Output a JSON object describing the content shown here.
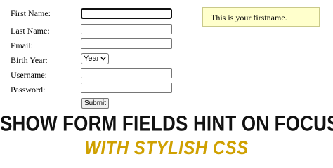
{
  "form": {
    "fields": {
      "first_name": {
        "label": "First Name:",
        "value": ""
      },
      "last_name": {
        "label": "Last Name:",
        "value": ""
      },
      "email": {
        "label": "Email:",
        "value": ""
      },
      "birth_year": {
        "label": "Birth Year:",
        "selected": "Year"
      },
      "username": {
        "label": "Username:",
        "value": ""
      },
      "password": {
        "label": "Password:",
        "value": ""
      }
    },
    "submit_label": "Submit",
    "focused_field": "first_name"
  },
  "hint": {
    "text": "This is your firstname."
  },
  "headline": {
    "line1": "SHOW FORM FIELDS HINT ON FOCUS",
    "line2": "WITH STYLISH CSS"
  },
  "colors": {
    "hint_background": "#ffffcc",
    "headline_primary": "#111111",
    "headline_accent": "#cfa000"
  },
  "icons": {
    "select_arrow": "chevron-down-icon"
  }
}
